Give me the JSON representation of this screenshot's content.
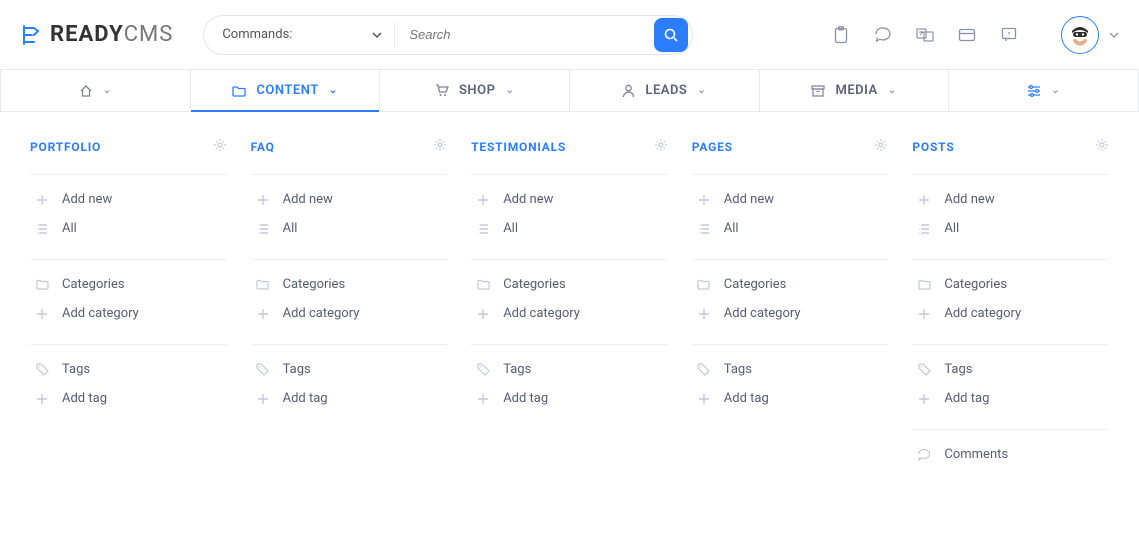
{
  "commands": {
    "label": "Commands:",
    "search_placeholder": "Search"
  },
  "nav": {
    "content": "CONTENT",
    "shop": "SHOP",
    "leads": "LEADS",
    "media": "MEDIA"
  },
  "common": {
    "add_new": "Add new",
    "all": "All",
    "categories": "Categories",
    "add_category": "Add category",
    "tags": "Tags",
    "add_tag": "Add tag",
    "comments": "Comments"
  },
  "columns": {
    "portfolio": "PORTFOLIO",
    "faq": "FAQ",
    "testimonials": "TESTIMONIALS",
    "pages": "PAGES",
    "posts": "POSTS"
  }
}
